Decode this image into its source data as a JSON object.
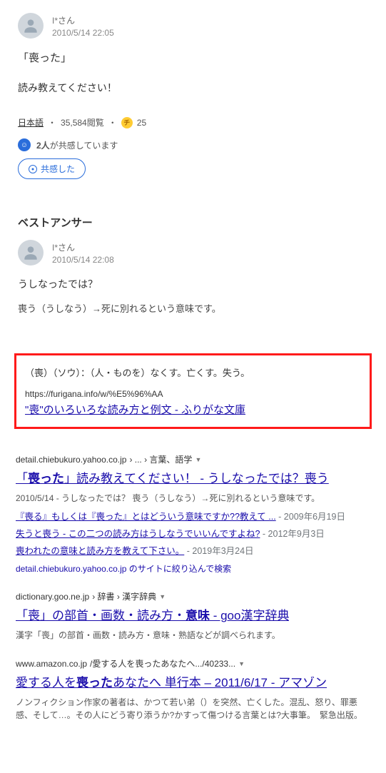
{
  "question": {
    "username": "I*",
    "suffix": "さん",
    "timestamp": "2010/5/14 22:05",
    "title": "「喪った」",
    "body": "読み教えてください！",
    "category": "日本語",
    "views": "35,584閲覧",
    "coins": "25",
    "sympathize_count": "2人",
    "sympathize_text": "が共感しています",
    "share_label": "共感した"
  },
  "best_answer": {
    "heading": "ベストアンサー",
    "username": "I*",
    "suffix": "さん",
    "timestamp": "2010/5/14 22:08",
    "line1": "うしなったでは？",
    "line2": "喪う（うしなう）→死に別れるという意味です。"
  },
  "highlight": {
    "def": "（喪）（ソウ）：（人・ものを）なくす。亡くす。失う。",
    "url": "https://furigana.info/w/%E5%96%AA",
    "link_text": "\"喪\"のいろいろな読み方と例文 - ふりがな文庫"
  },
  "serp": [
    {
      "domain": "detail.chiebukuro.yahoo.co.jp",
      "path": "› ... › 言葉、語学",
      "title_html": "「<b>喪った</b>」読み教えてください！ - うしなったでは？喪う",
      "snippet": "2010/5/14 - うしなったでは？ 喪う（うしなう）→死に別れるという意味です。",
      "related": [
        {
          "text": "『喪る』もしくは『喪った』とはどういう意味ですか??教えて ...",
          "date": "2009年6月19日"
        },
        {
          "text": "失うと喪う - この二つの読み方はうしなうでいいんですよね?",
          "date": "2012年9月3日"
        },
        {
          "text": "喪われたの意味と読み方を教えて下さい。",
          "date": "2019年3月24日"
        }
      ],
      "more": "detail.chiebukuro.yahoo.co.jp のサイトに絞り込んで検索"
    },
    {
      "domain": "dictionary.goo.ne.jp",
      "path": "› 辞書 › 漢字辞典",
      "title_html": "「喪」の部首・画数・読み方・<b>意味</b> - goo漢字辞典",
      "snippet": "漢字「喪」の部首・画数・読み方・意味・熟語などが調べられます。"
    },
    {
      "domain": "www.amazon.co.jp",
      "path": "/愛する人を喪ったあなたへ.../40233...",
      "title_html": "愛する人を<b>喪った</b>あなたへ 単行本 – 2011/6/17 - アマゾン",
      "snippet": "ノンフィクション作家の著者は、かつて若い弟（）を突然、亡くした。混乱、怒り、罪悪感、そして…。その人にどう寄り添うか?かすって傷つける言葉とは?大事筆。　緊急出版。"
    }
  ]
}
